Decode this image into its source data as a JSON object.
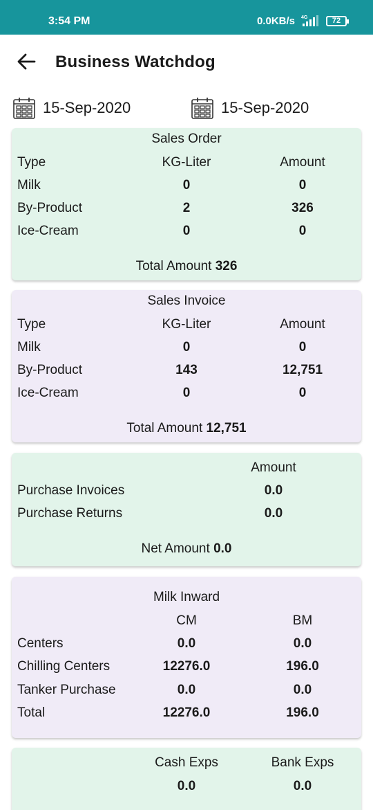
{
  "status_bar": {
    "time": "3:54 PM",
    "network_speed": "0.0KB/s",
    "network_type": "4G",
    "battery": "72"
  },
  "app_bar": {
    "title": "Business Watchdog",
    "back_icon": "arrow-left-icon"
  },
  "date_range": {
    "from": "15-Sep-2020",
    "to": "15-Sep-2020",
    "icon": "calendar-icon"
  },
  "sales_order": {
    "title": "Sales Order",
    "headers": [
      "Type",
      "KG-Liter",
      "Amount"
    ],
    "rows": [
      {
        "type": "Milk",
        "qty": "0",
        "amount": "0"
      },
      {
        "type": "By-Product",
        "qty": "2",
        "amount": "326"
      },
      {
        "type": "Ice-Cream",
        "qty": "0",
        "amount": "0"
      }
    ],
    "total_label": "Total Amount",
    "total_value": "326"
  },
  "sales_invoice": {
    "title": "Sales Invoice",
    "headers": [
      "Type",
      "KG-Liter",
      "Amount"
    ],
    "rows": [
      {
        "type": "Milk",
        "qty": "0",
        "amount": "0"
      },
      {
        "type": "By-Product",
        "qty": "143",
        "amount": "12,751"
      },
      {
        "type": "Ice-Cream",
        "qty": "0",
        "amount": "0"
      }
    ],
    "total_label": "Total Amount",
    "total_value": "12,751"
  },
  "purchase": {
    "header": "Amount",
    "rows": [
      {
        "label": "Purchase Invoices",
        "amount": "0.0"
      },
      {
        "label": "Purchase Returns",
        "amount": "0.0"
      }
    ],
    "net_label": "Net Amount",
    "net_value": "0.0"
  },
  "milk_inward": {
    "title": "Milk Inward",
    "headers": [
      "CM",
      "BM"
    ],
    "rows": [
      {
        "label": "Centers",
        "cm": "0.0",
        "bm": "0.0"
      },
      {
        "label": "Chilling Centers",
        "cm": "12276.0",
        "bm": "196.0"
      },
      {
        "label": "Tanker Purchase",
        "cm": "0.0",
        "bm": "0.0"
      },
      {
        "label": "Total",
        "cm": "12276.0",
        "bm": "196.0"
      }
    ]
  },
  "expenses": {
    "headers": [
      "Cash Exps",
      "Bank Exps"
    ],
    "values": [
      "0.0",
      "0.0"
    ]
  },
  "colors": {
    "status_bar": "#17959c",
    "card_green": "#e2f4ea",
    "card_purple": "#f0ebf7"
  }
}
